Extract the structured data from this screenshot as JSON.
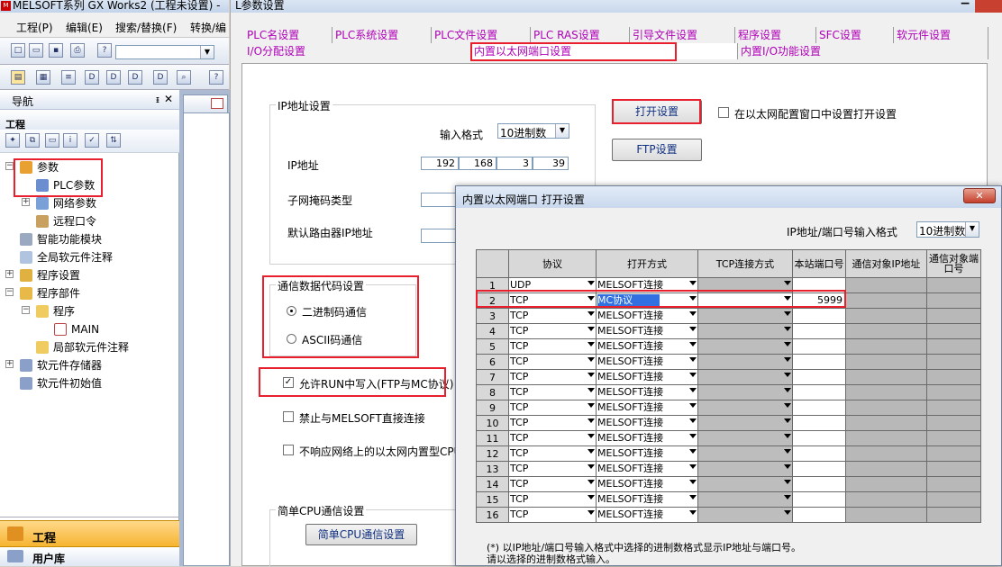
{
  "app": {
    "title": "MELSOFT系列 GX Works2 (工程未设置) -",
    "icon": "MELSOFT-app-icon"
  },
  "menu": [
    "工程(P)",
    "编辑(E)",
    "搜索/替换(F)",
    "转换/编"
  ],
  "nav": {
    "title": "导航",
    "pin": "ᵻ",
    "close": "✕",
    "project_label": "工程",
    "tree": [
      {
        "label": "参数",
        "icon": "param-icon"
      },
      {
        "label": "PLC参数",
        "icon": "plc-param-icon"
      },
      {
        "label": "网络参数",
        "icon": "network-icon"
      },
      {
        "label": "远程口令",
        "icon": "lock-icon"
      },
      {
        "label": "智能功能模块",
        "icon": "module-icon"
      },
      {
        "label": "全局软元件注释",
        "icon": "comment-icon"
      },
      {
        "label": "程序设置",
        "icon": "program-setting-icon"
      },
      {
        "label": "程序部件",
        "icon": "program-parts-icon"
      },
      {
        "label": "程序",
        "icon": "folder-icon"
      },
      {
        "label": "MAIN",
        "icon": "ladder-icon"
      },
      {
        "label": "局部软元件注释",
        "icon": "comment-icon"
      },
      {
        "label": "软元件存储器",
        "icon": "memory-icon"
      },
      {
        "label": "软元件初始值",
        "icon": "init-icon"
      }
    ],
    "btn_project": "工程",
    "btn_library": "用户库"
  },
  "param": {
    "title": "L参数设置",
    "tabs_row1": [
      "PLC名设置",
      "PLC系统设置",
      "PLC文件设置",
      "PLC RAS设置",
      "引导文件设置",
      "程序设置",
      "SFC设置",
      "软元件设置"
    ],
    "tabs_row2": [
      "I/O分配设置",
      "内置以太网端口设置",
      "内置I/O功能设置"
    ],
    "ip_group": "IP地址设置",
    "input_format_label": "输入格式",
    "input_format_value": "10进制数",
    "ip_label": "IP地址",
    "ip": [
      "192",
      "168",
      "3",
      "39"
    ],
    "subnet_label": "子网掩码类型",
    "gateway_label": "默认路由器IP地址",
    "comm_group": "通信数据代码设置",
    "radio_binary": "二进制码通信",
    "radio_ascii": "ASCII码通信",
    "allow_run_write": "允许RUN中写入(FTP与MC协议)",
    "check_mark": "✓",
    "prohibit_direct": "禁止与MELSOFT直接连接",
    "no_response": "不响应网络上的以太网内置型CPU",
    "simple_cpu_group": "简单CPU通信设置",
    "simple_cpu_btn": "简单CPU通信设置",
    "open_settings_btn": "打开设置",
    "ftp_btn": "FTP设置",
    "open_in_eth_config": "在以太网配置窗口中设置打开设置"
  },
  "open_dialog": {
    "title": "内置以太网端口 打开设置",
    "close": "✕",
    "format_label": "IP地址/端口号输入格式",
    "format_value": "10进制数",
    "headers": [
      "协议",
      "打开方式",
      "TCP连接方式",
      "本站端口号",
      "通信对象IP地址",
      "通信对象端口号"
    ],
    "rows": [
      {
        "no": "1",
        "protocol": "UDP",
        "open": "MELSOFT连接",
        "tcp": "",
        "port": ""
      },
      {
        "no": "2",
        "protocol": "TCP",
        "open": "MC协议",
        "tcp": "",
        "port": "5999"
      },
      {
        "no": "3",
        "protocol": "TCP",
        "open": "MELSOFT连接",
        "tcp": "",
        "port": ""
      },
      {
        "no": "4",
        "protocol": "TCP",
        "open": "MELSOFT连接",
        "tcp": "",
        "port": ""
      },
      {
        "no": "5",
        "protocol": "TCP",
        "open": "MELSOFT连接",
        "tcp": "",
        "port": ""
      },
      {
        "no": "6",
        "protocol": "TCP",
        "open": "MELSOFT连接",
        "tcp": "",
        "port": ""
      },
      {
        "no": "7",
        "protocol": "TCP",
        "open": "MELSOFT连接",
        "tcp": "",
        "port": ""
      },
      {
        "no": "8",
        "protocol": "TCP",
        "open": "MELSOFT连接",
        "tcp": "",
        "port": ""
      },
      {
        "no": "9",
        "protocol": "TCP",
        "open": "MELSOFT连接",
        "tcp": "",
        "port": ""
      },
      {
        "no": "10",
        "protocol": "TCP",
        "open": "MELSOFT连接",
        "tcp": "",
        "port": ""
      },
      {
        "no": "11",
        "protocol": "TCP",
        "open": "MELSOFT连接",
        "tcp": "",
        "port": ""
      },
      {
        "no": "12",
        "protocol": "TCP",
        "open": "MELSOFT连接",
        "tcp": "",
        "port": ""
      },
      {
        "no": "13",
        "protocol": "TCP",
        "open": "MELSOFT连接",
        "tcp": "",
        "port": ""
      },
      {
        "no": "14",
        "protocol": "TCP",
        "open": "MELSOFT连接",
        "tcp": "",
        "port": ""
      },
      {
        "no": "15",
        "protocol": "TCP",
        "open": "MELSOFT连接",
        "tcp": "",
        "port": ""
      },
      {
        "no": "16",
        "protocol": "TCP",
        "open": "MELSOFT连接",
        "tcp": "",
        "port": ""
      }
    ],
    "note1": "(*) 以IP地址/端口号输入格式中选择的进制数格式显示IP地址与端口号。",
    "note2": "请以选择的进制数格式输入。"
  },
  "colors": {
    "highlight": "#e81f2c",
    "tab_text": "#b000b8",
    "selection": "#3070e0"
  }
}
